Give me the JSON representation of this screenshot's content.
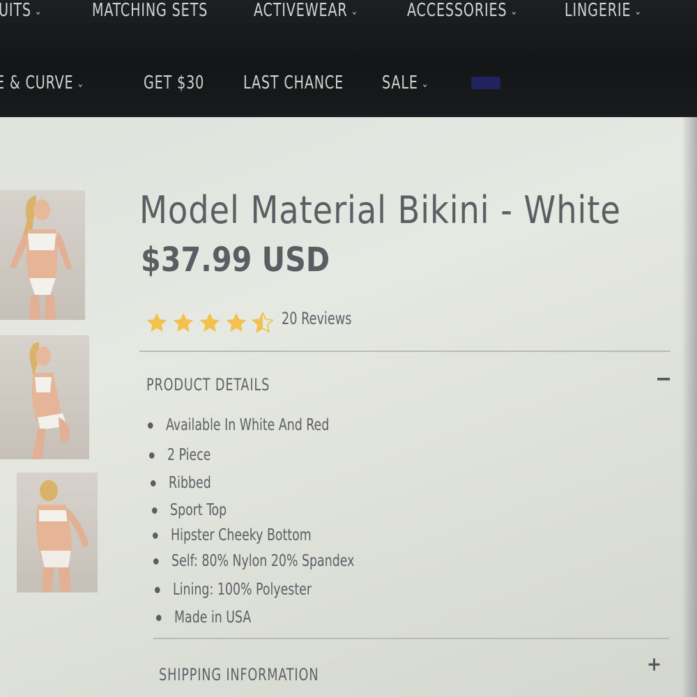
{
  "nav": {
    "row1": [
      {
        "label": "UITS",
        "chevron": true
      },
      {
        "label": "MATCHING SETS",
        "chevron": false
      },
      {
        "label": "ACTIVEWEAR",
        "chevron": true
      },
      {
        "label": "ACCESSORIES",
        "chevron": true
      },
      {
        "label": "LINGERIE",
        "chevron": true
      }
    ],
    "row2": [
      {
        "label": "E & CURVE",
        "chevron": true
      },
      {
        "label": "GET $30",
        "chevron": false
      },
      {
        "label": "LAST CHANCE",
        "chevron": false
      },
      {
        "label": "SALE",
        "chevron": true
      }
    ],
    "highlight_color": "#3b3fd8",
    "chevron_glyph": "⌄"
  },
  "product": {
    "title": "Model Material Bikini - White",
    "price": "$37.99 USD",
    "rating": 4.5,
    "rating_max": 5,
    "reviews_label": "20 Reviews",
    "star_color": "#f2c14e"
  },
  "details": {
    "heading": "PRODUCT DETAILS",
    "toggle": "−",
    "items": [
      "Available In White And Red",
      "2 Piece",
      "Ribbed",
      "Sport Top",
      "Hipster Cheeky Bottom",
      "Self: 80% Nylon 20% Spandex",
      "Lining: 100% Polyester",
      "Made in USA"
    ]
  },
  "shipping": {
    "heading": "SHIPPING INFORMATION",
    "toggle": "+"
  },
  "thumbnails": [
    {
      "name": "product-thumbnail-front"
    },
    {
      "name": "product-thumbnail-side"
    },
    {
      "name": "product-thumbnail-back"
    }
  ]
}
